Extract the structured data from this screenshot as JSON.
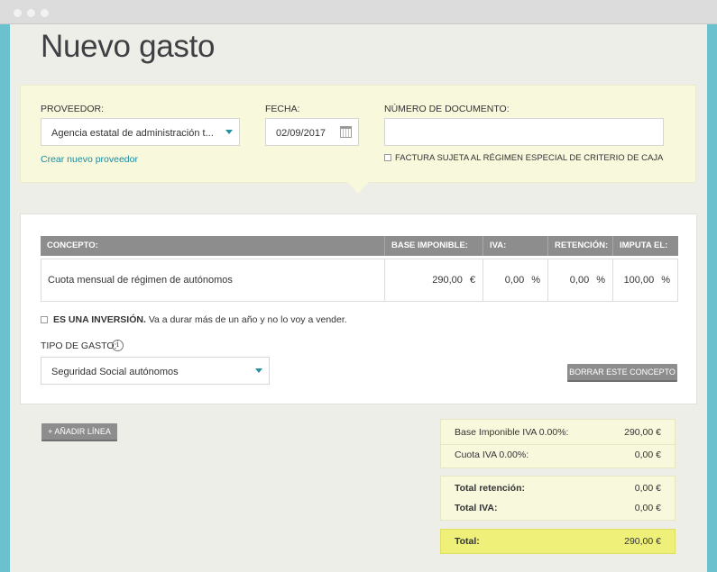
{
  "page": {
    "title": "Nuevo gasto"
  },
  "header": {
    "proveedor_label": "PROVEEDOR:",
    "proveedor_value": "Agencia estatal de administración t...",
    "crear_proveedor_link": "Crear nuevo proveedor",
    "fecha_label": "FECHA:",
    "fecha_value": "02/09/2017",
    "numero_label": "NÚMERO DE DOCUMENTO:",
    "numero_value": "",
    "criterio_caja_label": "FACTURA SUJETA AL RÉGIMEN ESPECIAL DE CRITERIO DE CAJA"
  },
  "concept_table": {
    "columns": [
      "CONCEPTO:",
      "BASE IMPONIBLE:",
      "IVA:",
      "RETENCIÓN:",
      "IMPUTA EL:"
    ],
    "row": {
      "concepto": "Cuota mensual de régimen de autónomos",
      "base": "290,00",
      "base_unit": "€",
      "iva": "0,00",
      "iva_unit": "%",
      "retencion": "0,00",
      "retencion_unit": "%",
      "imputa": "100,00",
      "imputa_unit": "%"
    }
  },
  "inversion": {
    "bold_label": "ES UNA INVERSIÓN.",
    "rest_label": "Va a durar más de un año y no lo voy a vender."
  },
  "tipo_gasto": {
    "label": "TIPO DE GASTO:",
    "info_icon": "i",
    "value": "Seguridad Social autónomos"
  },
  "buttons": {
    "borrar": "BORRAR ESTE CONCEPTO",
    "anadir": "+ AÑADIR LÍNEA"
  },
  "totals": {
    "base_label": "Base Imponible IVA 0.00%:",
    "base_value": "290,00 €",
    "cuota_label": "Cuota IVA 0.00%:",
    "cuota_value": "0,00 €",
    "retencion_label": "Total retención:",
    "retencion_value": "0,00 €",
    "iva_label": "Total IVA:",
    "iva_value": "0,00 €",
    "total_label": "Total:",
    "total_value": "290,00 €"
  },
  "colors": {
    "accent": "#1b8b9c",
    "panel_yellow": "#f8f8dd",
    "total_highlight": "#eef07a",
    "header_grey": "#8d8d8d",
    "page_bg": "#eeeee9",
    "frame_teal": "#6cc1cf"
  }
}
